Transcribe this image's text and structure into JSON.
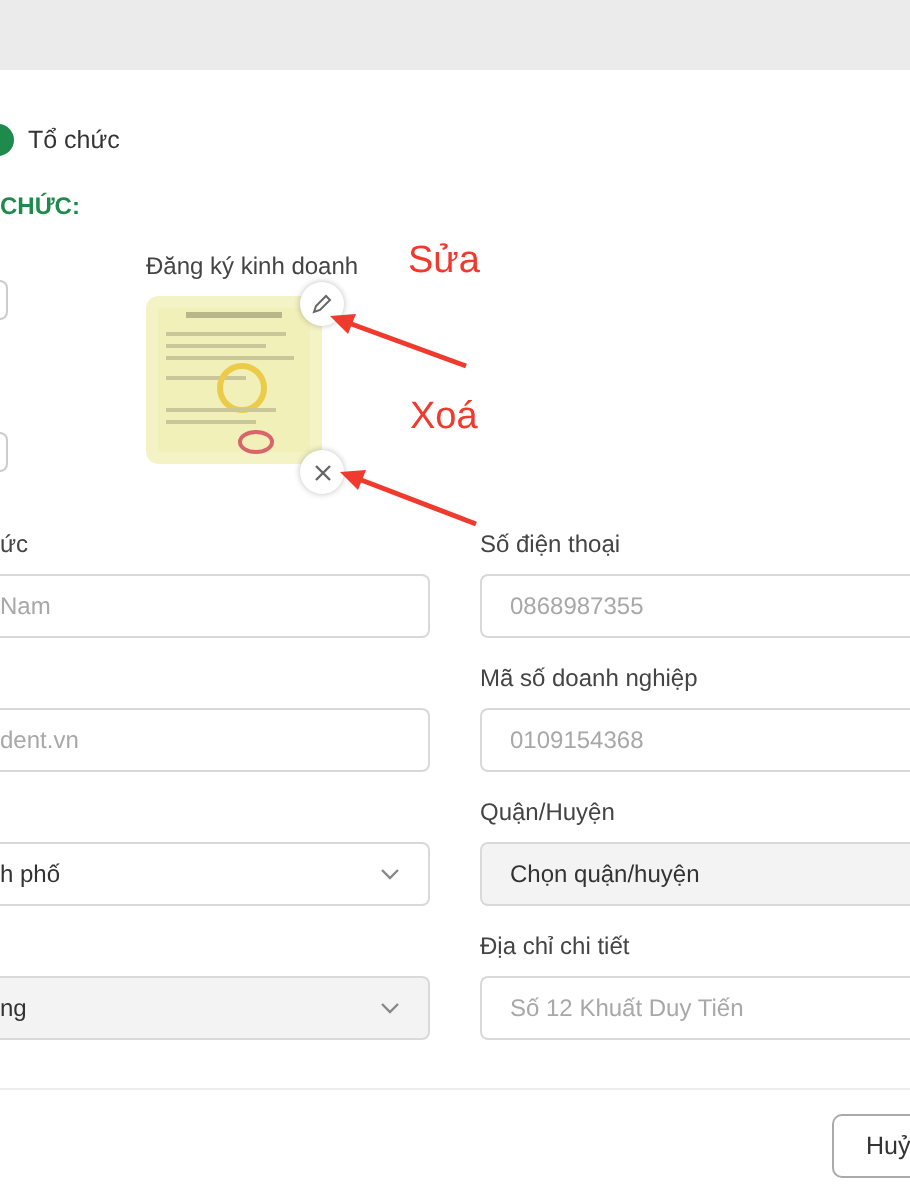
{
  "radio": {
    "label": "Tổ chức",
    "selected": true
  },
  "section_title": "CHỨC:",
  "document": {
    "label": "Đăng ký kinh doanh"
  },
  "annotations": [
    {
      "text": "Sửa"
    },
    {
      "text": "Xoá"
    }
  ],
  "rows": [
    {
      "left": {
        "label": "ức",
        "kind": "input",
        "placeholder": "Nam"
      },
      "right": {
        "label": "Số điện thoại",
        "kind": "input",
        "placeholder": "0868987355"
      }
    },
    {
      "left": {
        "kind": "input",
        "placeholder": "dent.vn"
      },
      "right": {
        "label": "Mã số doanh nghiệp",
        "kind": "input",
        "placeholder": "0109154368"
      }
    },
    {
      "left": {
        "kind": "select",
        "value": "h phố",
        "disabled": false
      },
      "right": {
        "label": "Quận/Huyện",
        "kind": "select",
        "value": "Chọn quận/huyện",
        "disabled": true
      }
    },
    {
      "left": {
        "kind": "select",
        "value": "ng",
        "disabled": true
      },
      "right": {
        "label": "Địa chỉ chi tiết",
        "kind": "input",
        "placeholder": "Số 12 Khuất Duy Tiến"
      }
    }
  ],
  "footer_buttons": [
    "Huỷ"
  ]
}
